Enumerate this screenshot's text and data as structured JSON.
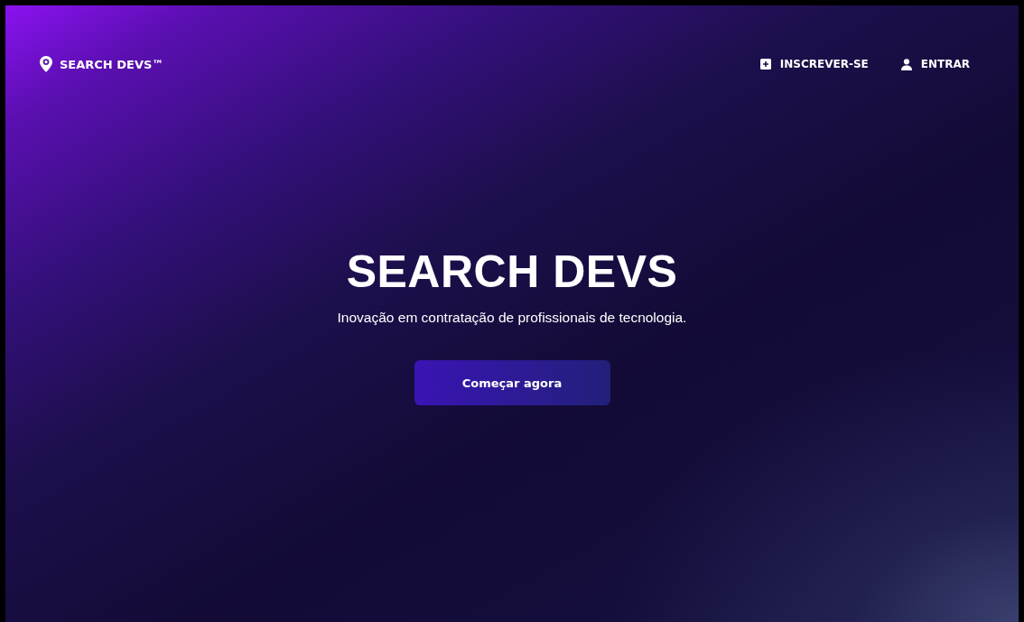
{
  "header": {
    "logo": "SEARCH DEVS™",
    "nav": [
      {
        "kind": "signup",
        "label": "INSCREVER-SE"
      },
      {
        "kind": "login",
        "label": "ENTRAR"
      }
    ]
  },
  "hero": {
    "title": "SEARCH DEVS",
    "subtitle": "Inovação em contratação de profissionais de tecnologia.",
    "button": "Começar agora"
  }
}
